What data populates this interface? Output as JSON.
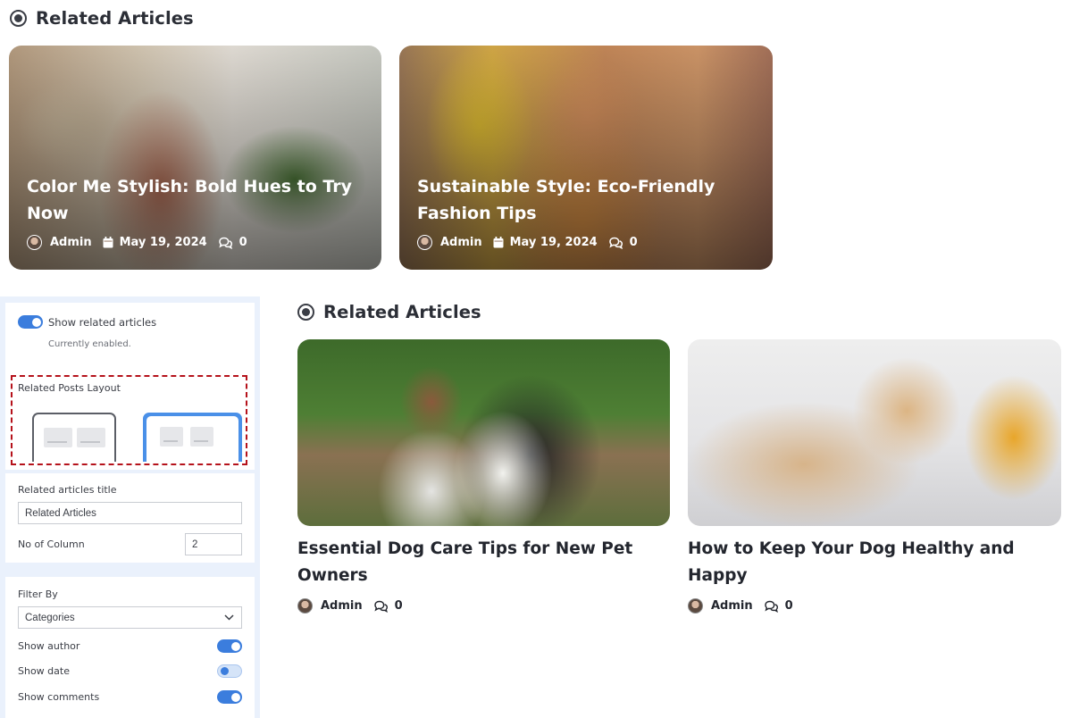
{
  "section_title": "Related Articles",
  "top_cards": [
    {
      "title": "Color Me Stylish: Bold Hues to Try Now",
      "author": "Admin",
      "date": "May 19, 2024",
      "comments": "0"
    },
    {
      "title": "Sustainable Style: Eco-Friendly Fashion Tips",
      "author": "Admin",
      "date": "May 19, 2024",
      "comments": "0"
    }
  ],
  "grid_cards": [
    {
      "title": "Essential Dog Care Tips for New Pet Owners",
      "author": "Admin",
      "comments": "0"
    },
    {
      "title": "How to Keep Your Dog Healthy and Happy",
      "author": "Admin",
      "comments": "0"
    }
  ],
  "settings": {
    "show_related": {
      "label": "Show related articles",
      "status": "Currently enabled.",
      "enabled": true
    },
    "layout": {
      "label": "Related Posts Layout",
      "options": [
        "list",
        "grid"
      ],
      "selected": "grid"
    },
    "title_field": {
      "label": "Related articles title",
      "value": "Related Articles"
    },
    "columns": {
      "label": "No of Column",
      "value": "2"
    },
    "filter": {
      "label": "Filter By",
      "value": "Categories"
    },
    "toggles": [
      {
        "label": "Show author",
        "on": true
      },
      {
        "label": "Show date",
        "on": false
      },
      {
        "label": "Show comments",
        "on": true
      }
    ]
  },
  "colors": {
    "accent": "#3b7ddd",
    "panel_bg": "#eaf1fc",
    "highlight_border": "#b5121b"
  },
  "icons": [
    "radio-selected-icon",
    "calendar-icon",
    "comment-icon",
    "chevron-down-icon",
    "avatar"
  ]
}
